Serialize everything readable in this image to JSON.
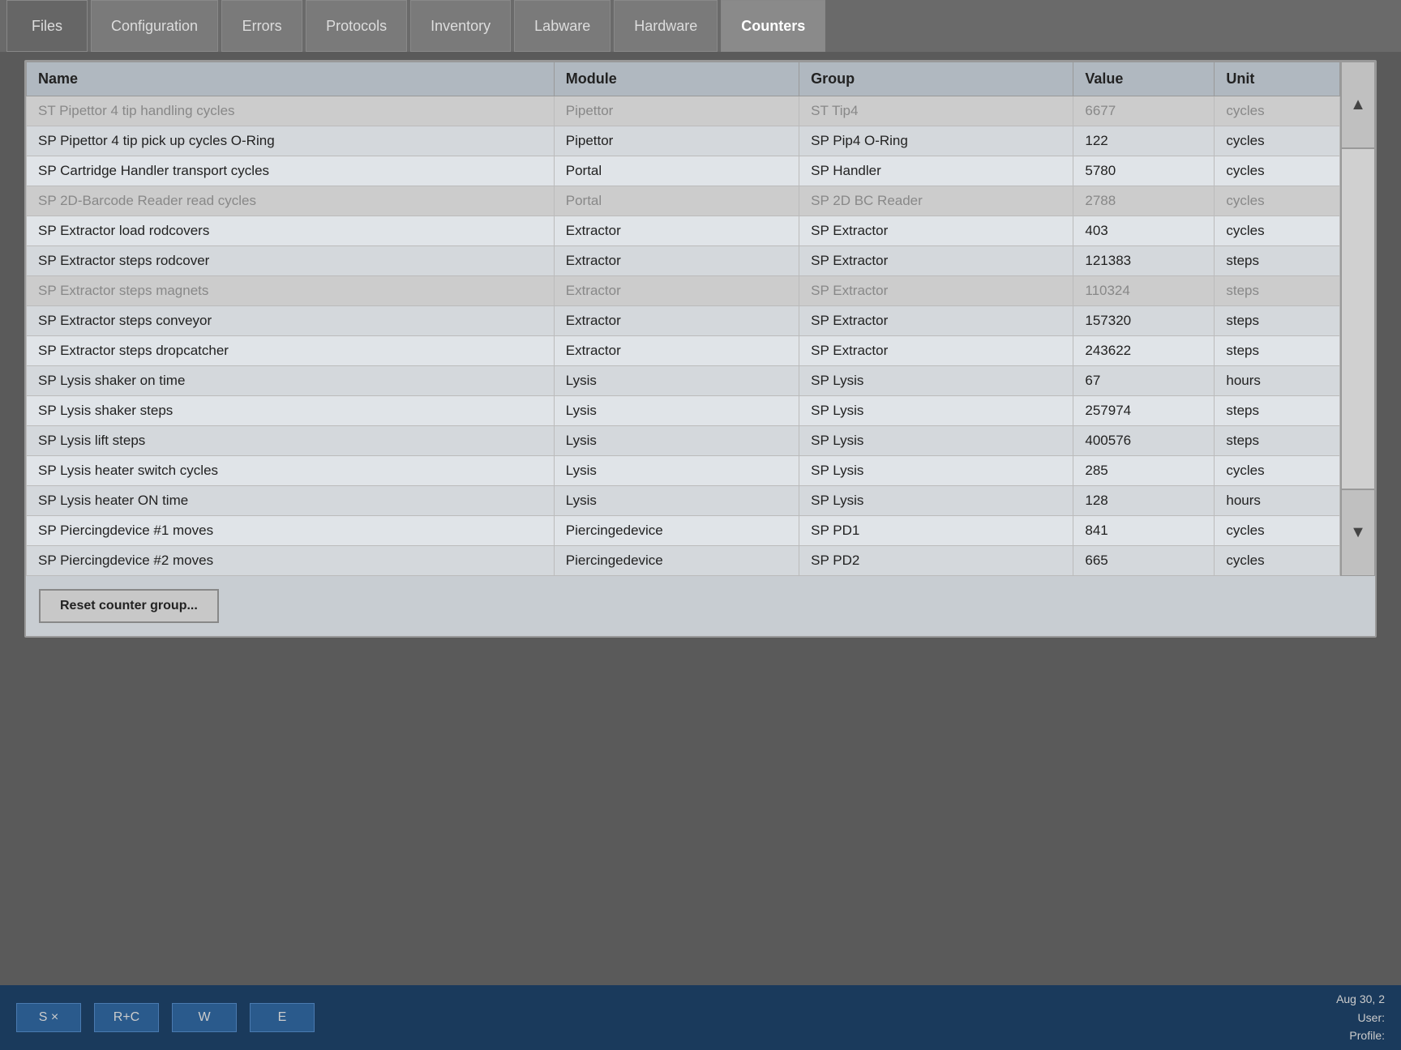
{
  "nav": {
    "tabs": [
      {
        "label": "Files",
        "active": false
      },
      {
        "label": "Configuration",
        "active": false
      },
      {
        "label": "Errors",
        "active": false
      },
      {
        "label": "Protocols",
        "active": false
      },
      {
        "label": "Inventory",
        "active": false
      },
      {
        "label": "Labware",
        "active": false
      },
      {
        "label": "Hardware",
        "active": false
      },
      {
        "label": "Counters",
        "active": true
      }
    ]
  },
  "table": {
    "headers": [
      "Name",
      "Module",
      "Group",
      "Value",
      "Unit"
    ],
    "rows": [
      {
        "name": "ST Pipettor 4 tip handling cycles",
        "module": "Pipettor",
        "group": "ST Tip4",
        "value": "6677",
        "unit": "cycles",
        "faded": true
      },
      {
        "name": "SP Pipettor 4 tip pick up cycles O-Ring",
        "module": "Pipettor",
        "group": "SP Pip4 O-Ring",
        "value": "122",
        "unit": "cycles",
        "faded": false
      },
      {
        "name": "SP Cartridge Handler transport cycles",
        "module": "Portal",
        "group": "SP Handler",
        "value": "5780",
        "unit": "cycles",
        "faded": false
      },
      {
        "name": "SP 2D-Barcode Reader read cycles",
        "module": "Portal",
        "group": "SP 2D BC Reader",
        "value": "2788",
        "unit": "cycles",
        "faded": true
      },
      {
        "name": "SP Extractor load rodcovers",
        "module": "Extractor",
        "group": "SP Extractor",
        "value": "403",
        "unit": "cycles",
        "faded": false
      },
      {
        "name": "SP Extractor steps rodcover",
        "module": "Extractor",
        "group": "SP Extractor",
        "value": "121383",
        "unit": "steps",
        "faded": false
      },
      {
        "name": "SP Extractor steps magnets",
        "module": "Extractor",
        "group": "SP Extractor",
        "value": "110324",
        "unit": "steps",
        "faded": true
      },
      {
        "name": "SP Extractor steps conveyor",
        "module": "Extractor",
        "group": "SP Extractor",
        "value": "157320",
        "unit": "steps",
        "faded": false
      },
      {
        "name": "SP Extractor steps dropcatcher",
        "module": "Extractor",
        "group": "SP Extractor",
        "value": "243622",
        "unit": "steps",
        "faded": false
      },
      {
        "name": "SP Lysis shaker on time",
        "module": "Lysis",
        "group": "SP Lysis",
        "value": "67",
        "unit": "hours",
        "faded": false
      },
      {
        "name": "SP Lysis shaker steps",
        "module": "Lysis",
        "group": "SP Lysis",
        "value": "257974",
        "unit": "steps",
        "faded": false
      },
      {
        "name": "SP Lysis lift steps",
        "module": "Lysis",
        "group": "SP Lysis",
        "value": "400576",
        "unit": "steps",
        "faded": false
      },
      {
        "name": "SP Lysis heater switch cycles",
        "module": "Lysis",
        "group": "SP Lysis",
        "value": "285",
        "unit": "cycles",
        "faded": false
      },
      {
        "name": "SP Lysis heater ON time",
        "module": "Lysis",
        "group": "SP Lysis",
        "value": "128",
        "unit": "hours",
        "faded": false
      },
      {
        "name": "SP Piercingdevice #1 moves",
        "module": "Piercingedevice",
        "group": "SP PD1",
        "value": "841",
        "unit": "cycles",
        "faded": false
      },
      {
        "name": "SP Piercingdevice #2 moves",
        "module": "Piercingedevice",
        "group": "SP PD2",
        "value": "665",
        "unit": "cycles",
        "faded": false
      }
    ]
  },
  "buttons": {
    "reset_label": "Reset counter group...",
    "scroll_up": "▲",
    "scroll_down": "▼"
  },
  "bottom_bar": {
    "keys": [
      "S ×",
      "R+C",
      "W",
      "E"
    ],
    "info": {
      "date": "Aug 30, 2",
      "user_label": "User:",
      "profile_label": "Profile:"
    }
  }
}
